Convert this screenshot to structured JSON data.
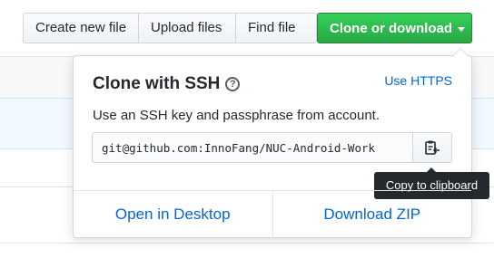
{
  "toolbar": {
    "create_label": "Create new file",
    "upload_label": "Upload files",
    "find_label": "Find file",
    "clone_label": "Clone or download"
  },
  "clone_popover": {
    "title": "Clone with SSH",
    "use_https_label": "Use HTTPS",
    "description": "Use an SSH key and passphrase from account.",
    "clone_url": "git@github.com:InnoFang/NUC-Android-Work",
    "copy_tooltip": "Copy to clipboard",
    "open_desktop_label": "Open in Desktop",
    "download_zip_label": "Download ZIP"
  },
  "colors": {
    "primary": "#28a745",
    "link": "#0366d6",
    "tooltip_bg": "#24292e"
  }
}
